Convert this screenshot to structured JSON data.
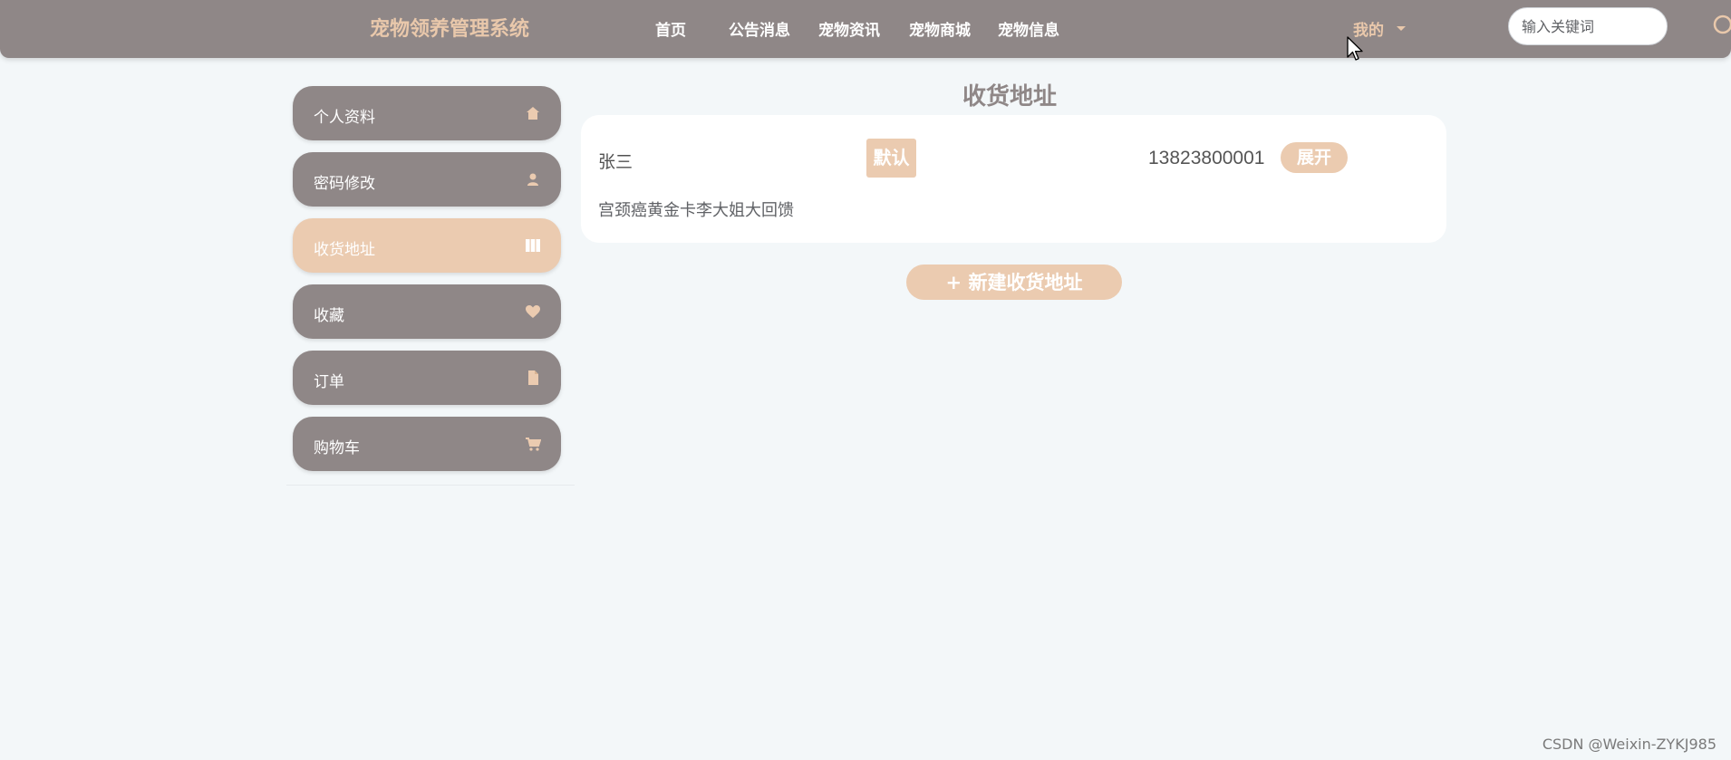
{
  "header": {
    "brand": "宠物领养管理系统",
    "nav": [
      "首页",
      "公告消息",
      "宠物资讯",
      "宠物商城",
      "宠物信息"
    ],
    "user_menu_label": "我的",
    "search_placeholder": "输入关键词"
  },
  "sidebar": {
    "items": [
      {
        "label": "个人资料",
        "icon": "home-icon",
        "active": false
      },
      {
        "label": "密码修改",
        "icon": "user-icon",
        "active": false
      },
      {
        "label": "收货地址",
        "icon": "map-icon",
        "active": true
      },
      {
        "label": "收藏",
        "icon": "heart-icon",
        "active": false
      },
      {
        "label": "订单",
        "icon": "document-icon",
        "active": false
      },
      {
        "label": "购物车",
        "icon": "cart-icon",
        "active": false
      }
    ]
  },
  "main": {
    "title": "收货地址",
    "address": {
      "name": "张三",
      "default_label": "默认",
      "phone": "13823800001",
      "expand_label": "展开",
      "detail": "宫颈癌黄金卡李大姐大回馈"
    },
    "add_label": "+ 新建收货地址"
  },
  "watermark": "CSDN @Weixin-ZYKJ985",
  "colors": {
    "header_bg": "#8f8787",
    "accent": "#ebcbb0",
    "brand_text": "#e9c8ab",
    "page_bg": "#f3f7f9"
  }
}
